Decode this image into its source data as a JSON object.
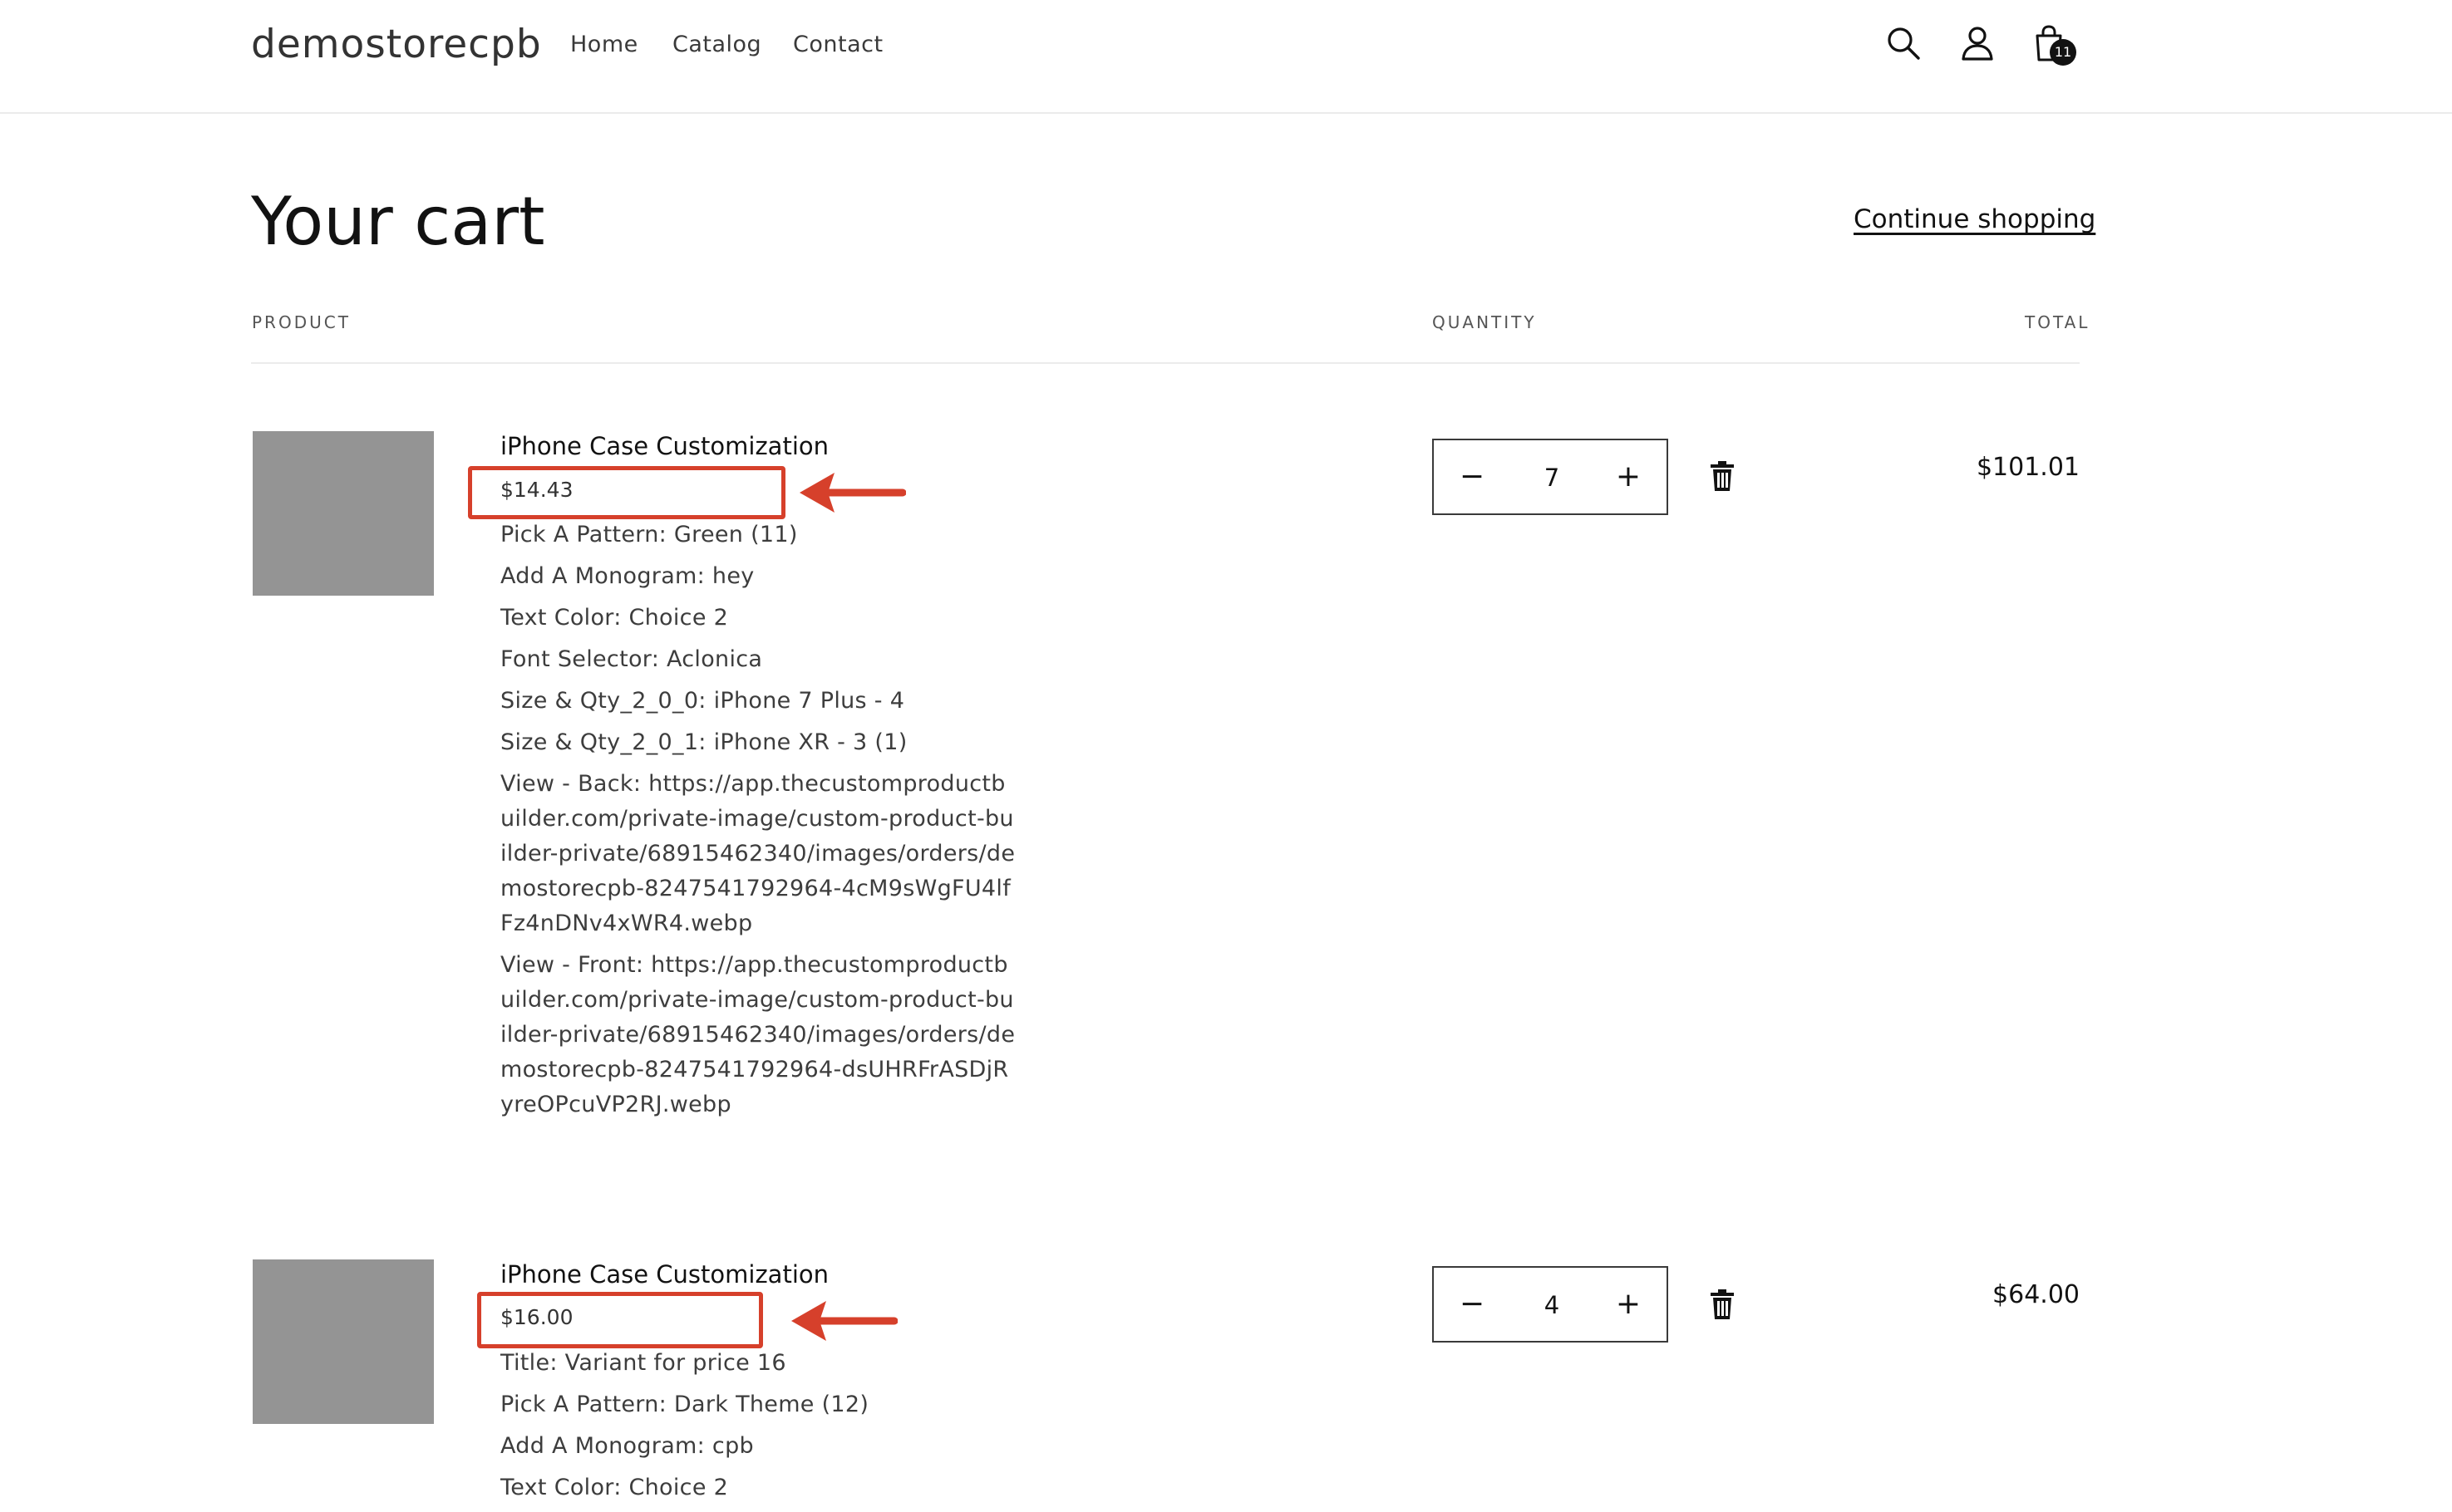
{
  "header": {
    "logo": "demostorecpb",
    "nav": [
      "Home",
      "Catalog",
      "Contact"
    ],
    "icons": [
      "search-icon",
      "account-icon",
      "cart-icon"
    ],
    "cart_count": "11"
  },
  "page": {
    "title": "Your cart",
    "continue_label": "Continue shopping"
  },
  "columns": {
    "product": "PRODUCT",
    "quantity": "QUANTITY",
    "total": "TOTAL"
  },
  "items": [
    {
      "name": "iPhone Case Customization",
      "price": "$14.43",
      "options": [
        "Pick A Pattern: Green (11)",
        "Add A Monogram: hey",
        "Text Color: Choice 2",
        "Font Selector: Aclonica",
        "Size & Qty_2_0_0: iPhone 7 Plus - 4",
        "Size & Qty_2_0_1: iPhone XR - 3 (1)",
        "View - Back: https://app.thecustomproductbuilder.com/private-image/custom-product-builder-private/68915462340/images/orders/demostorecpb-8247541792964-4cM9sWgFU4lfFz4nDNv4xWR4.webp",
        "View - Front: https://app.thecustomproductbuilder.com/private-image/custom-product-builder-private/68915462340/images/orders/demostorecpb-8247541792964-dsUHRFrASDjRyreOPcuVP2RJ.webp"
      ],
      "quantity": "7",
      "total": "$101.01"
    },
    {
      "name": "iPhone Case Customization",
      "price": "$16.00",
      "options": [
        "Title: Variant for price 16",
        "Pick A Pattern: Dark Theme (12)",
        "Add A Monogram: cpb",
        "Text Color: Choice 2"
      ],
      "quantity": "4",
      "total": "$64.00"
    }
  ],
  "controls": {
    "minus": "−",
    "plus": "+"
  },
  "annotation_color": "#d6402b",
  "placeholder_color": "#949494"
}
